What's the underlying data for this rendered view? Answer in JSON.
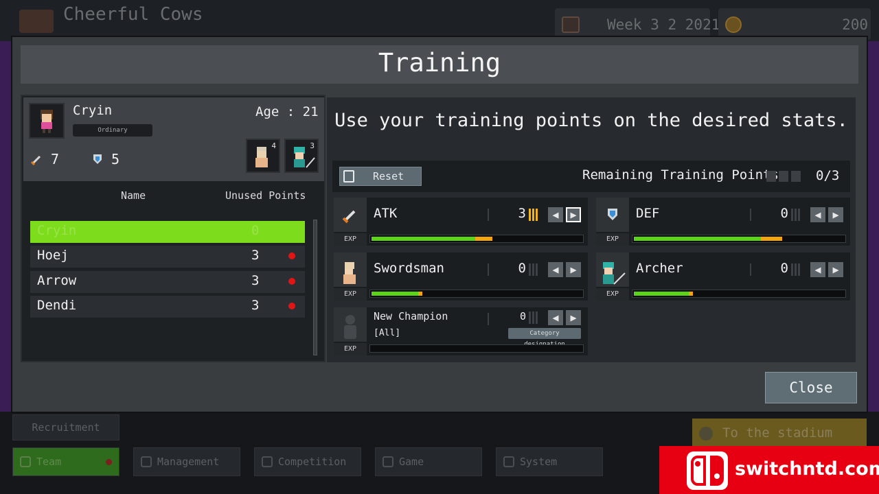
{
  "background": {
    "team_name": "Cheerful Cows",
    "date": "Week 3 2 2021",
    "money": "200",
    "recruitment": "Recruitment",
    "to_stadium": "To the stadium",
    "nav": [
      "Team",
      "Management",
      "Competition",
      "Game",
      "System"
    ]
  },
  "dialog": {
    "title": "Training",
    "instruction": "Use your training points on the desired stats.",
    "reset_label": "Reset",
    "remaining_label": "Remaining Training Points",
    "remaining_count": "0/3",
    "close_label": "Close"
  },
  "profile": {
    "name": "Cryin",
    "age": "Age : 21",
    "rank": "Ordinary",
    "atk": "7",
    "def": "5",
    "class_levels": [
      "4",
      "3"
    ]
  },
  "list": {
    "headers": {
      "name": "Name",
      "points": "Unused Points"
    },
    "rows": [
      {
        "name": "Cryin",
        "points": "0",
        "dot": false
      },
      {
        "name": "Hoej",
        "points": "3",
        "dot": true
      },
      {
        "name": "Arrow",
        "points": "3",
        "dot": true
      },
      {
        "name": "Dendi",
        "points": "3",
        "dot": true
      }
    ]
  },
  "stats": {
    "exp_label": "EXP",
    "atk": {
      "label": "ATK",
      "value": "3",
      "points_level": 3,
      "exp_fill": 0.49,
      "exp_pending": 0.08
    },
    "def": {
      "label": "DEF",
      "value": "0",
      "points_level": 0,
      "exp_fill": 0.6,
      "exp_pending": 0.1
    },
    "swordsman": {
      "label": "Swordsman",
      "value": "0",
      "points_level": 0,
      "exp_fill": 0.22,
      "exp_pending": 0.02
    },
    "archer": {
      "label": "Archer",
      "value": "0",
      "points_level": 0,
      "exp_fill": 0.26,
      "exp_pending": 0.02
    },
    "new_champion": {
      "label": "New Champion",
      "sub": "[All]",
      "value": "0",
      "tag": "Category designation",
      "exp_fill": 0
    }
  },
  "colors": {
    "selected_row": "#7ddc1b",
    "exp_green": "#5bd316",
    "exp_orange": "#f2a50c",
    "points_gold": "#f0b41f",
    "notify_dot": "#e11515"
  }
}
